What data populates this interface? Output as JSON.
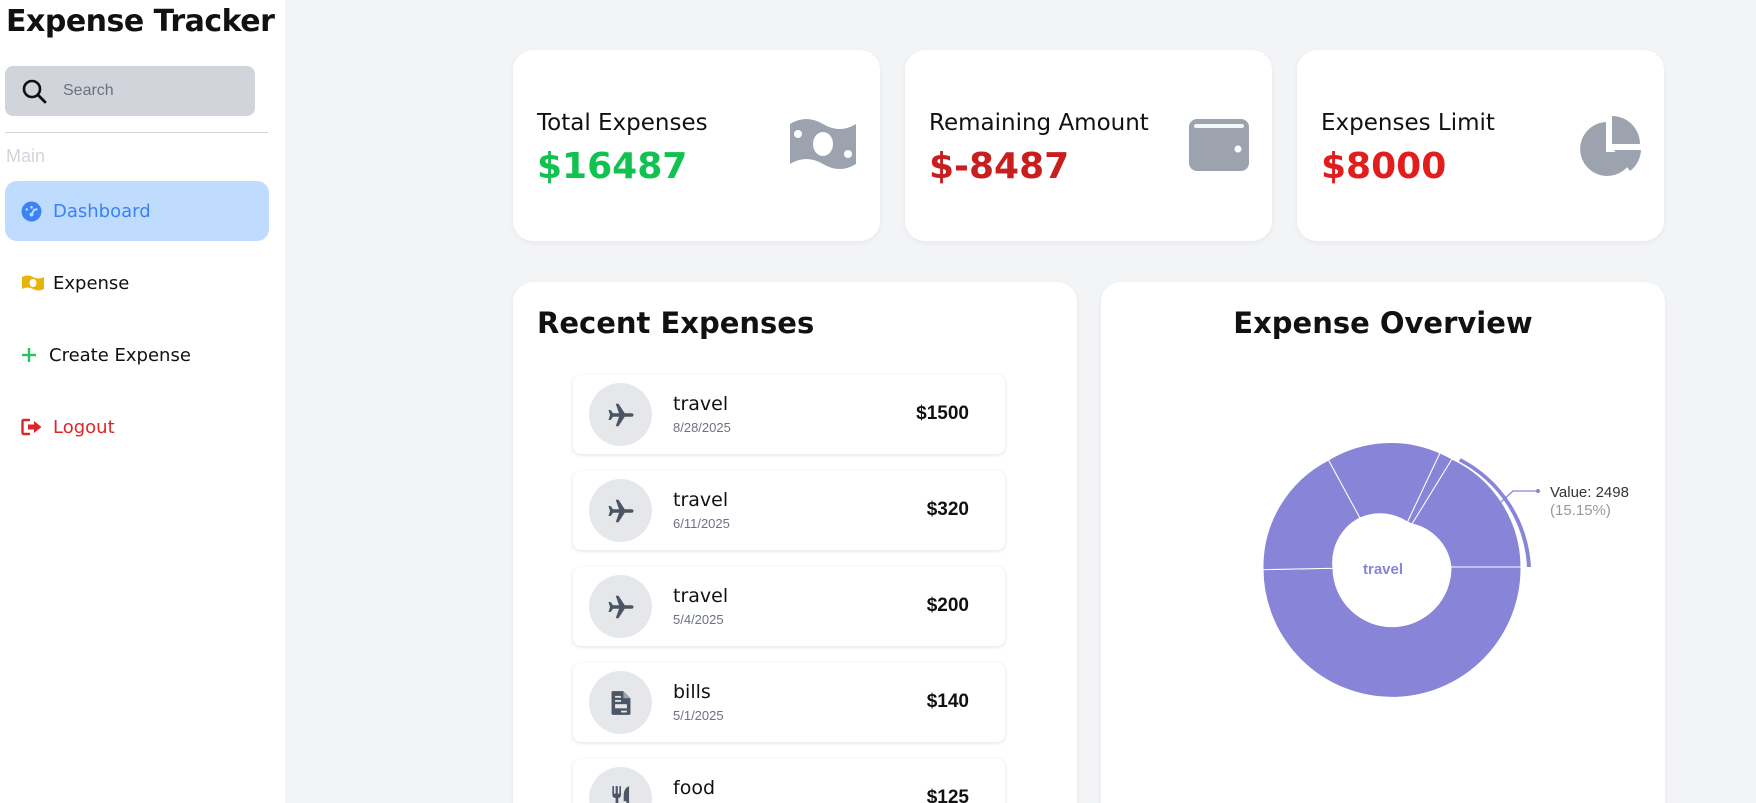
{
  "app": {
    "title": "Expense Tracker"
  },
  "search": {
    "placeholder": "Search"
  },
  "nav": {
    "section_label": "Main",
    "items": [
      {
        "label": "Dashboard",
        "icon": "gauge-icon"
      },
      {
        "label": "Expense",
        "icon": "money-bill-icon"
      },
      {
        "label": "Create Expense",
        "icon": "plus-icon"
      },
      {
        "label": "Logout",
        "icon": "logout-icon"
      }
    ]
  },
  "stats": [
    {
      "label": "Total Expenses",
      "value": "$16487",
      "color": "#10c24f",
      "icon": "money-bill-icon"
    },
    {
      "label": "Remaining Amount",
      "value": "$-8487",
      "color": "#c81e1e",
      "icon": "wallet-icon"
    },
    {
      "label": "Expenses Limit",
      "value": "$8000",
      "color": "#e11d1d",
      "icon": "pie-chart-icon"
    }
  ],
  "recent": {
    "title": "Recent Expenses",
    "items": [
      {
        "category": "travel",
        "date": "8/28/2025",
        "amount": "$1500",
        "icon": "plane-icon"
      },
      {
        "category": "travel",
        "date": "6/11/2025",
        "amount": "$320",
        "icon": "plane-icon"
      },
      {
        "category": "travel",
        "date": "5/4/2025",
        "amount": "$200",
        "icon": "plane-icon"
      },
      {
        "category": "bills",
        "date": "5/1/2025",
        "amount": "$140",
        "icon": "file-invoice-icon"
      },
      {
        "category": "food",
        "date": "",
        "amount": "$125",
        "icon": "utensils-icon"
      }
    ]
  },
  "overview": {
    "title": "Expense Overview",
    "center_label": "travel",
    "tooltip_value": "Value: 2498",
    "tooltip_pct": "(15.15%)",
    "color": "#8884d8"
  },
  "chart_data": {
    "type": "pie",
    "values": [
      16487
    ],
    "highlighted_slice": {
      "category": "travel",
      "value": 2498,
      "percent": 15.15
    }
  }
}
